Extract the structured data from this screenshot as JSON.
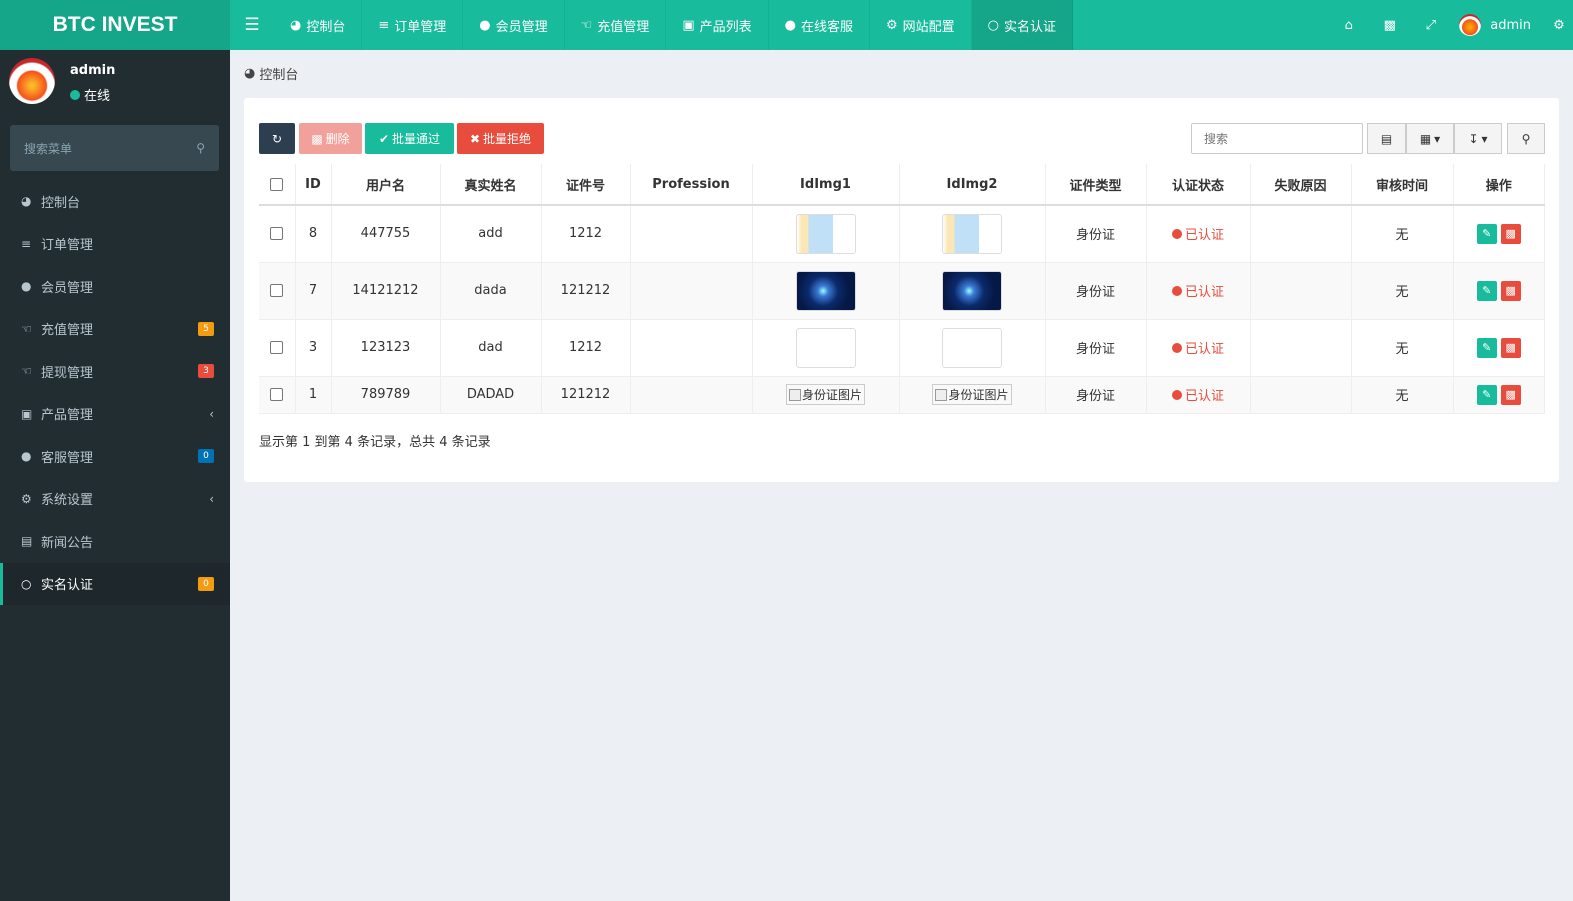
{
  "app": {
    "title": "BTC INVEST"
  },
  "topnav": {
    "items": [
      {
        "label": "控制台",
        "icon": "dashboard-icon"
      },
      {
        "label": "订单管理",
        "icon": "list-icon"
      },
      {
        "label": "会员管理",
        "icon": "users-icon"
      },
      {
        "label": "充值管理",
        "icon": "hand-icon"
      },
      {
        "label": "产品列表",
        "icon": "briefcase-icon"
      },
      {
        "label": "在线客服",
        "icon": "comments-icon"
      },
      {
        "label": "网站配置",
        "icon": "gear-icon"
      },
      {
        "label": "实名认证",
        "icon": "circle-icon"
      }
    ],
    "user": "admin"
  },
  "sidebar": {
    "user": {
      "name": "admin",
      "status": "在线"
    },
    "search": {
      "placeholder": "搜索菜单"
    },
    "items": [
      {
        "label": "控制台",
        "icon": "dashboard-icon",
        "badge": "",
        "badge_color": ""
      },
      {
        "label": "订单管理",
        "icon": "list-icon",
        "badge": "",
        "badge_color": ""
      },
      {
        "label": "会员管理",
        "icon": "users-icon",
        "badge": "",
        "badge_color": ""
      },
      {
        "label": "充值管理",
        "icon": "hand-icon",
        "badge": "5",
        "badge_color": "#f39c12"
      },
      {
        "label": "提现管理",
        "icon": "hand-icon",
        "badge": "3",
        "badge_color": "#e74c3c"
      },
      {
        "label": "产品管理",
        "icon": "briefcase-icon",
        "badge": "",
        "badge_color": ""
      },
      {
        "label": "客服管理",
        "icon": "comments-icon",
        "badge": "0",
        "badge_color": "#0073b7"
      },
      {
        "label": "系统设置",
        "icon": "cogs-icon",
        "badge": "",
        "badge_color": ""
      },
      {
        "label": "新闻公告",
        "icon": "newspaper-icon",
        "badge": "",
        "badge_color": ""
      },
      {
        "label": "实名认证",
        "icon": "circle-icon",
        "badge": "0",
        "badge_color": "#f39c12"
      }
    ]
  },
  "breadcrumb": {
    "label": "控制台"
  },
  "toolbar": {
    "delete_label": "删除",
    "approve_label": "批量通过",
    "reject_label": "批量拒绝",
    "search_placeholder": "搜索"
  },
  "table": {
    "headers": [
      "ID",
      "用户名",
      "真实姓名",
      "证件号",
      "Profession",
      "IdImg1",
      "IdImg2",
      "证件类型",
      "认证状态",
      "失败原因",
      "审核时间",
      "操作"
    ],
    "rows": [
      {
        "id": "8",
        "username": "447755",
        "realname": "add",
        "idnum": "1212",
        "profession": "",
        "img1": "document",
        "img2": "document",
        "idtype": "身份证",
        "status": "已认证",
        "reason": "",
        "time": "无"
      },
      {
        "id": "7",
        "username": "14121212",
        "realname": "dada",
        "idnum": "121212",
        "profession": "",
        "img1": "tech",
        "img2": "tech",
        "idtype": "身份证",
        "status": "已认证",
        "reason": "",
        "time": "无"
      },
      {
        "id": "3",
        "username": "123123",
        "realname": "dad",
        "idnum": "1212",
        "profession": "",
        "img1": "blank",
        "img2": "blank",
        "idtype": "身份证",
        "status": "已认证",
        "reason": "",
        "time": "无"
      },
      {
        "id": "1",
        "username": "789789",
        "realname": "DADAD",
        "idnum": "121212",
        "profession": "",
        "img1_alt": "身份证图片",
        "img2_alt": "身份证图片",
        "idtype": "身份证",
        "status": "已认证",
        "reason": "",
        "time": "无"
      }
    ]
  },
  "pagination": {
    "info": "显示第 1 到第 4 条记录，总共 4 条记录"
  },
  "colors": {
    "brand": "#18bc9c",
    "sidebar": "#222d32",
    "danger": "#e74c3c",
    "success": "#18bc9c",
    "dark": "#2c3e50"
  }
}
